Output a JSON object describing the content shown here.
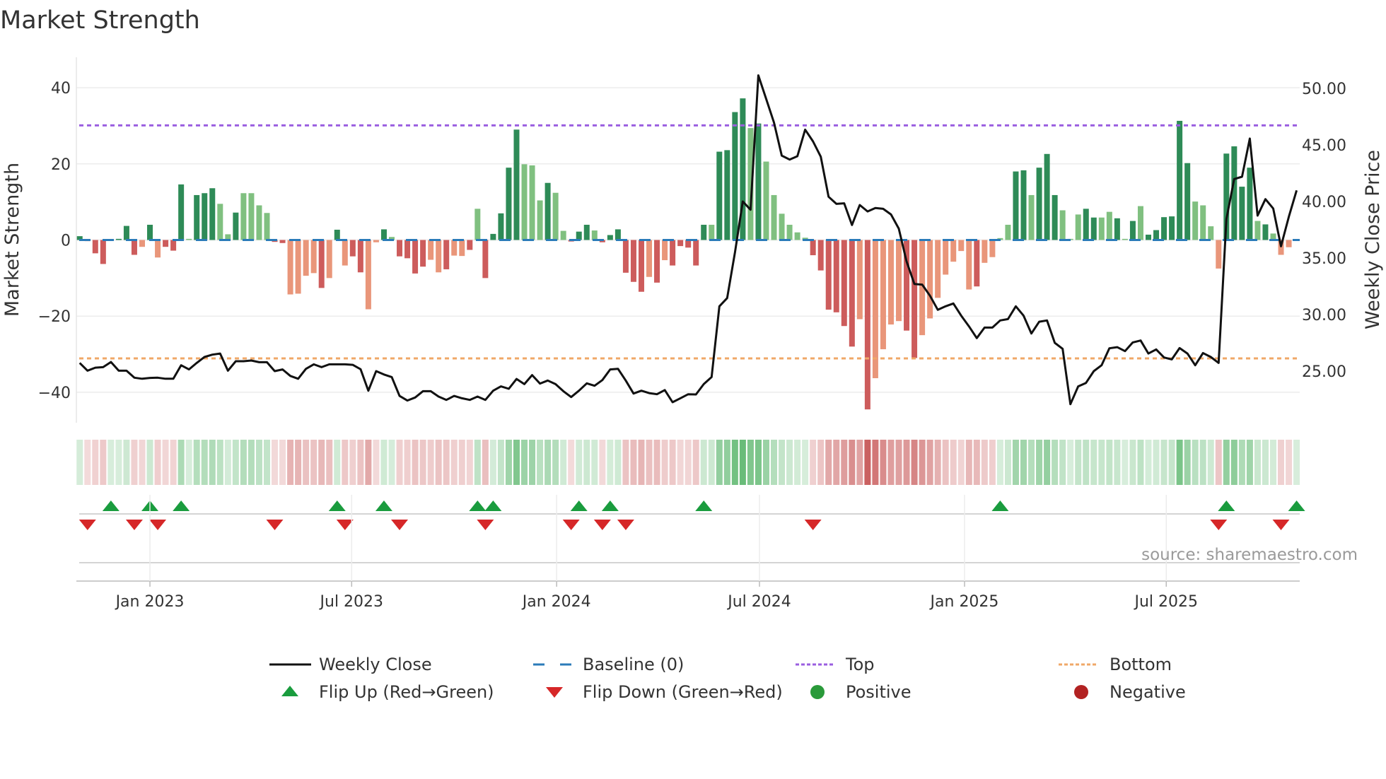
{
  "chart_data": {
    "type": "bar",
    "title": "Market Strength",
    "ylabel": "Market Strength",
    "ylabel_right": "Weekly Close Price",
    "source": "source: sharemaestro.com",
    "ylim": [
      -48,
      48
    ],
    "ylim_right": [
      20.44,
      52.75
    ],
    "xlim": [
      -0.43,
      156.4
    ],
    "yticks": [
      {
        "v": 40,
        "label": "40"
      },
      {
        "v": 20,
        "label": "20"
      },
      {
        "v": 0,
        "label": "0"
      },
      {
        "v": -20,
        "label": "−20"
      },
      {
        "v": -40,
        "label": "−40"
      }
    ],
    "yticks_right": [
      {
        "v": 50,
        "label": "50.00"
      },
      {
        "v": 45,
        "label": "45.00"
      },
      {
        "v": 40,
        "label": "40.00"
      },
      {
        "v": 35,
        "label": "35.00"
      },
      {
        "v": 30,
        "label": "30.00"
      },
      {
        "v": 25,
        "label": "25.00"
      }
    ],
    "xticks": [
      {
        "week": 9.0,
        "label": "Jan 2023"
      },
      {
        "week": 34.86,
        "label": "Jul 2023"
      },
      {
        "week": 61.14,
        "label": "Jan 2024"
      },
      {
        "week": 87.14,
        "label": "Jul 2024"
      },
      {
        "week": 113.43,
        "label": "Jan 2025"
      },
      {
        "week": 139.29,
        "label": "Jul 2025"
      }
    ],
    "top_level": 30.1,
    "bottom_level": -31.1,
    "baseline": 0,
    "strength": [
      1.0,
      -0.3,
      -3.5,
      -6.3,
      0.2,
      0.3,
      3.7,
      -3.9,
      -1.8,
      4.0,
      -4.6,
      -1.8,
      -2.8,
      14.6,
      0.3,
      11.8,
      12.3,
      13.6,
      9.5,
      1.5,
      7.2,
      12.3,
      12.3,
      9.1,
      7.1,
      -0.5,
      -0.8,
      -14.3,
      -14.1,
      -9.4,
      -8.7,
      -12.6,
      -10.0,
      2.7,
      -6.7,
      -4.3,
      -8.5,
      -18.2,
      -0.6,
      2.8,
      0.8,
      -4.3,
      -4.8,
      -8.8,
      -7.0,
      -5.2,
      -8.5,
      -7.7,
      -4.1,
      -4.2,
      -2.6,
      8.2,
      -10.0,
      1.6,
      7.0,
      19.0,
      29.0,
      19.9,
      19.6,
      10.4,
      15.0,
      12.4,
      2.4,
      -0.4,
      2.2,
      4.0,
      2.5,
      -0.6,
      1.3,
      2.8,
      -8.6,
      -11.0,
      -13.6,
      -9.7,
      -11.2,
      -5.3,
      -6.7,
      -1.6,
      -2.0,
      -6.7,
      4.0,
      4.0,
      23.2,
      23.6,
      33.6,
      37.2,
      29.4,
      30.6,
      20.6,
      11.8,
      6.9,
      4.0,
      2.0,
      0.6,
      -4.0,
      -8.0,
      -18.3,
      -19.0,
      -22.6,
      -28.0,
      -20.8,
      -44.5,
      -36.3,
      -28.7,
      -22.2,
      -21.3,
      -23.8,
      -31.0,
      -25.0,
      -20.6,
      -15.2,
      -9.1,
      -5.7,
      -2.9,
      -13.0,
      -12.2,
      -6.0,
      -4.5,
      0.5,
      4.0,
      18.0,
      18.3,
      11.8,
      19.0,
      22.6,
      11.8,
      7.8,
      0.3,
      6.7,
      8.2,
      5.9,
      5.9,
      7.4,
      5.7,
      0.3,
      5.0,
      8.9,
      1.4,
      2.6,
      6.0,
      6.2,
      31.3,
      20.2,
      10.1,
      9.1,
      3.6,
      -7.5,
      22.7,
      24.6,
      14.0,
      19.0,
      5.0,
      4.1,
      1.7,
      -3.9,
      -1.9,
      0.2
    ],
    "shade": "ddddddddldldddldddlldllllddlllldldlddlldlddddlldlldldddddllldlldddlddddddldldddddlddddldllllllddddddldllllddllllllldllllddldddlllddlldldlddddddllllddddldlllldlll",
    "weekly_close": [
      25.73,
      25.04,
      25.31,
      25.35,
      25.81,
      25.04,
      25.04,
      24.42,
      24.33,
      24.4,
      24.42,
      24.33,
      24.33,
      25.52,
      25.15,
      25.73,
      26.25,
      26.46,
      26.56,
      25.04,
      25.88,
      25.88,
      25.94,
      25.79,
      25.79,
      25.0,
      25.15,
      24.58,
      24.33,
      25.2,
      25.6,
      25.35,
      25.6,
      25.6,
      25.6,
      25.56,
      25.17,
      23.27,
      25.0,
      24.7,
      24.48,
      22.81,
      22.4,
      22.67,
      23.23,
      23.23,
      22.75,
      22.46,
      22.81,
      22.6,
      22.46,
      22.75,
      22.46,
      23.27,
      23.65,
      23.44,
      24.31,
      23.85,
      24.65,
      23.9,
      24.17,
      23.85,
      23.23,
      22.71,
      23.27,
      23.92,
      23.71,
      24.21,
      25.15,
      25.21,
      24.17,
      23.02,
      23.27,
      23.06,
      22.96,
      23.33,
      22.25,
      22.6,
      22.96,
      22.94,
      23.85,
      24.48,
      30.73,
      31.46,
      35.52,
      40.0,
      39.27,
      51.15,
      49.06,
      46.98,
      44.06,
      43.71,
      44.0,
      46.35,
      45.31,
      43.96,
      40.42,
      39.79,
      39.84,
      37.92,
      39.69,
      39.12,
      39.42,
      39.35,
      38.85,
      37.6,
      34.7,
      32.7,
      32.65,
      31.67,
      30.42,
      30.73,
      30.98,
      29.9,
      28.96,
      27.92,
      28.85,
      28.85,
      29.48,
      29.6,
      30.73,
      29.9,
      28.33,
      29.37,
      29.48,
      27.5,
      26.98,
      22.08,
      23.65,
      23.96,
      25.0,
      25.52,
      27.02,
      27.12,
      26.77,
      27.54,
      27.71,
      26.56,
      26.92,
      26.21,
      26.04,
      27.04,
      26.56,
      25.52,
      26.6,
      26.25,
      25.73,
      38.44,
      41.98,
      42.19,
      45.56,
      38.75,
      40.21,
      39.38,
      36.04,
      38.65,
      40.98
    ],
    "flip_up_weeks": [
      4,
      9,
      13,
      33,
      39,
      51,
      53,
      64,
      68,
      80,
      118,
      147,
      156
    ],
    "flip_down_weeks": [
      1,
      7,
      10,
      25,
      34,
      41,
      52,
      63,
      67,
      70,
      94,
      146,
      154
    ],
    "legend": [
      {
        "label": "Weekly Close",
        "kind": "line"
      },
      {
        "label": "Baseline (0)",
        "kind": "dash"
      },
      {
        "label": "Top",
        "kind": "dot-top"
      },
      {
        "label": "Bottom",
        "kind": "dot-bottom"
      },
      {
        "label": "Flip Up (Red→Green)",
        "kind": "tri-up"
      },
      {
        "label": "Flip Down (Green→Red)",
        "kind": "tri-down"
      },
      {
        "label": "Positive",
        "kind": "circle-pos"
      },
      {
        "label": "Negative",
        "kind": "circle-neg"
      }
    ],
    "legend_placement": "bottom-center",
    "colors": {
      "pos_dark": "#2e8b57",
      "pos_light": "#80c080",
      "neg_dark": "#cd5c5c",
      "neg_light": "#e9967a",
      "line": "#111111",
      "baseline": "#2b7bb9",
      "top": "#9b5fe0",
      "bottom": "#f0a868",
      "flip_up": "#1a9c3e",
      "flip_down": "#d62728",
      "positive": "#2a9a3a",
      "negative": "#b22222"
    }
  }
}
